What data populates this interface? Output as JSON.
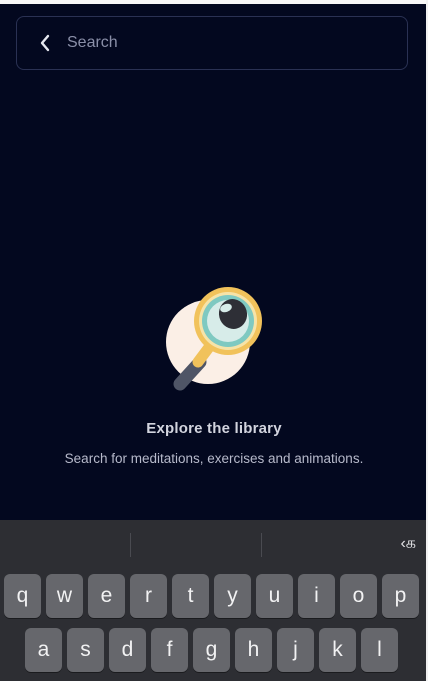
{
  "search": {
    "placeholder": "Search",
    "value": "",
    "back_icon": "chevron-left-icon"
  },
  "empty_state": {
    "illustration_icon": "magnifier-illustration-icon",
    "title": "Explore the library",
    "description": "Search for meditations, exercises and animations."
  },
  "keyboard": {
    "language_key": "‹க",
    "row1": [
      "q",
      "w",
      "e",
      "r",
      "t",
      "y",
      "u",
      "i",
      "o",
      "p"
    ],
    "row2": [
      "a",
      "s",
      "d",
      "f",
      "g",
      "h",
      "j",
      "k",
      "l"
    ]
  },
  "colors": {
    "background": "#03081f",
    "search_border": "#2a3153",
    "keyboard_bg": "#2d2e33",
    "key_bg": "#66676c",
    "lens_ring": "#f1c25b",
    "lens_inner": "#7fc9c1"
  }
}
